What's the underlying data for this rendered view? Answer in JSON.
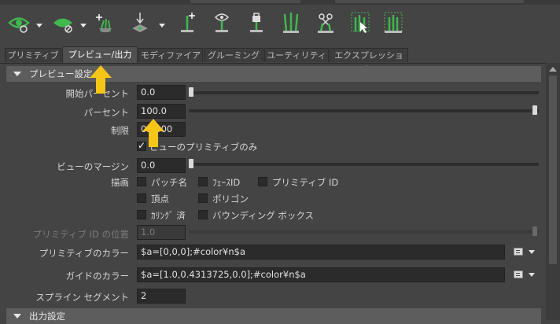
{
  "toolbar": {
    "icons": [
      "eye-dropdown-icon",
      "hide-dropdown-icon",
      "xgen-add-icon",
      "xgen-move-icon",
      "add-guide-icon",
      "view-guide-icon",
      "lock-guide-icon",
      "guides-icon",
      "cut-guide-icon",
      "select-guides-icon",
      "guide-box-icon"
    ]
  },
  "tabs": [
    {
      "label": "プリミティブ"
    },
    {
      "label": "プレビュー/出力"
    },
    {
      "label": "モディファイア"
    },
    {
      "label": "グルーミング"
    },
    {
      "label": "ユーティリティ"
    },
    {
      "label": "エクスプレッション"
    }
  ],
  "preview_section": {
    "title": "プレビュー設定",
    "start_percent": {
      "label": "開始パーセント",
      "value": "0.0",
      "fraction": 0.0
    },
    "percent": {
      "label": "パーセント",
      "value": "100.0",
      "fraction": 1.0
    },
    "limit": {
      "label": "制限",
      "value": "0.0000"
    },
    "view_primitives_only": {
      "label": "ビューのプリミティブのみ",
      "checked": true
    },
    "view_margin": {
      "label": "ビューのマージン",
      "value": "0.0",
      "fraction": 0.0
    },
    "draw": {
      "label": "描画",
      "patch_name": "パッチ名",
      "face_id": "ﾌｪｰｽID",
      "primitive_id": "プリミティブ ID",
      "vertices": "頂点",
      "polygon": "ポリゴン",
      "culled": "ｶﾘﾝｸﾞ 済",
      "bounding_box": "バウンディング ボックス"
    },
    "primitive_id_position": {
      "label": "プリミティブ ID の位置",
      "value": "1.0",
      "fraction": 1.0
    },
    "primitive_color": {
      "label": "プリミティブのカラー",
      "value": "$a=[0,0,0];#color¥n$a"
    },
    "guide_color": {
      "label": "ガイドのカラー",
      "value": "$a=[1.0,0.4313725,0.0];#color¥n$a"
    },
    "spline_segments": {
      "label": "スプライン セグメント",
      "value": "2"
    }
  },
  "output_section": {
    "title": "出力設定"
  },
  "colors": {
    "callout": "#f5c518",
    "accent_green": "#3fb84f",
    "background": "#444444"
  }
}
